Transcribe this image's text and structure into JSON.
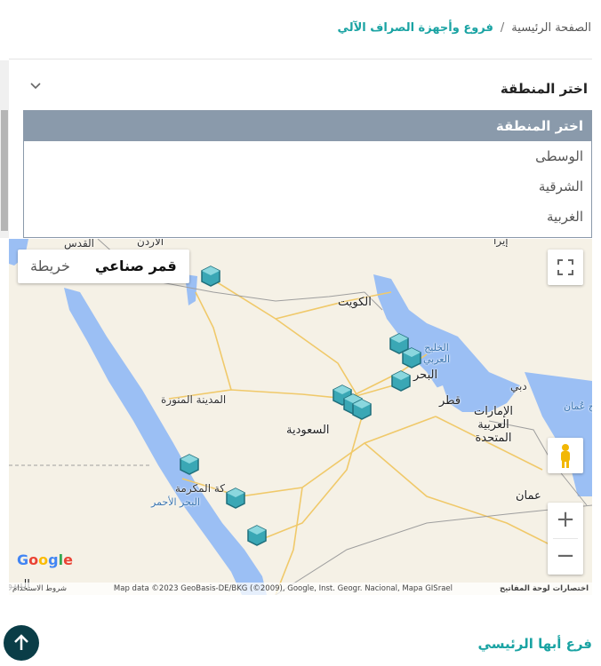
{
  "breadcrumb": {
    "home": "الصفحة الرئيسية",
    "separator": "/",
    "current": "فروع وأجهزة الصراف الآلي"
  },
  "region_select": {
    "label": "اختر المنطقة",
    "options": [
      "اختر المنطقة",
      "الوسطى",
      "الشرقية",
      "الغربية"
    ],
    "selected": "اختر المنطقة"
  },
  "map": {
    "type_buttons": {
      "map": "خريطة",
      "satellite": "قمر صناعي"
    },
    "labels": {
      "kuwait": "الكويت",
      "saudi": "السعودية",
      "medina": "المدينة المنورة",
      "mecca": "كة المكرمة",
      "gulf": "الخليج العربي",
      "bahrain": "البحر",
      "qatar": "قطر",
      "uae": "الإمارات العربية المتحدة",
      "dubai": "دبي",
      "oman": "عمان",
      "oman_sea": "خليج عُمان",
      "red_sea": "البحر الأحمر",
      "jordan": "الأردن",
      "quds": "القدس",
      "iran": "إيرا",
      "sudan": "السو"
    },
    "markers": [
      {
        "id": "north"
      },
      {
        "id": "riyadh-1"
      },
      {
        "id": "riyadh-2"
      },
      {
        "id": "riyadh-3"
      },
      {
        "id": "east-1"
      },
      {
        "id": "east-2"
      },
      {
        "id": "east-3"
      },
      {
        "id": "jeddah"
      },
      {
        "id": "taif"
      },
      {
        "id": "abha"
      }
    ],
    "google": "Google",
    "shortcuts": "اختصارات لوحة المفاتيح",
    "attribution": "Map data ©2023 GeoBasis-DE/BKG (©2009), Google, Inst. Geogr. Nacional, Mapa GISrael",
    "terms": "شروط الاستخدام",
    "zoom_in": "+",
    "zoom_out": "−"
  },
  "branch": {
    "title": "فرع أبها الرئيسي"
  },
  "scroll_top_icon": "arrow-up-icon",
  "colors": {
    "accent": "#1aa3a3",
    "selected_option": "#8a9aab",
    "sea": "#9bbff4",
    "land": "#f5f1e6",
    "top_button": "#0a3d47"
  }
}
